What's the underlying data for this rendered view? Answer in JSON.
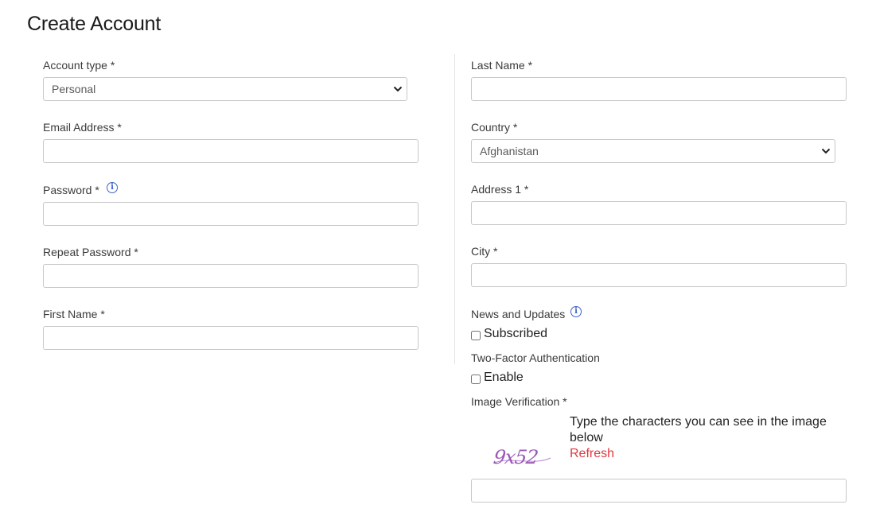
{
  "page": {
    "title": "Create Account"
  },
  "left": {
    "account_type": {
      "label": "Account type *",
      "value": "Personal"
    },
    "email": {
      "label": "Email Address *",
      "value": ""
    },
    "password": {
      "label": "Password *",
      "value": ""
    },
    "repeat_password": {
      "label": "Repeat Password *",
      "value": ""
    },
    "first_name": {
      "label": "First Name *",
      "value": ""
    }
  },
  "right": {
    "last_name": {
      "label": "Last Name *",
      "value": ""
    },
    "country": {
      "label": "Country *",
      "value": "Afghanistan"
    },
    "address1": {
      "label": "Address 1 *",
      "value": ""
    },
    "city": {
      "label": "City *",
      "value": ""
    },
    "news": {
      "label": "News and Updates",
      "checkbox_label": "Subscribed",
      "checked": false
    },
    "two_factor": {
      "label": "Two-Factor Authentication",
      "checkbox_label": "Enable",
      "checked": false
    },
    "captcha": {
      "label": "Image Verification *",
      "instructions": "Type the characters you can see in the image below",
      "refresh_label": "Refresh",
      "image_text": "9x52",
      "value": ""
    }
  },
  "icons": {
    "info": "info-icon",
    "dropdown": "chevron-down-icon"
  },
  "colors": {
    "info_icon": "#3d63c9",
    "refresh_link": "#e0373f",
    "captcha_text": "#9b59b6"
  }
}
